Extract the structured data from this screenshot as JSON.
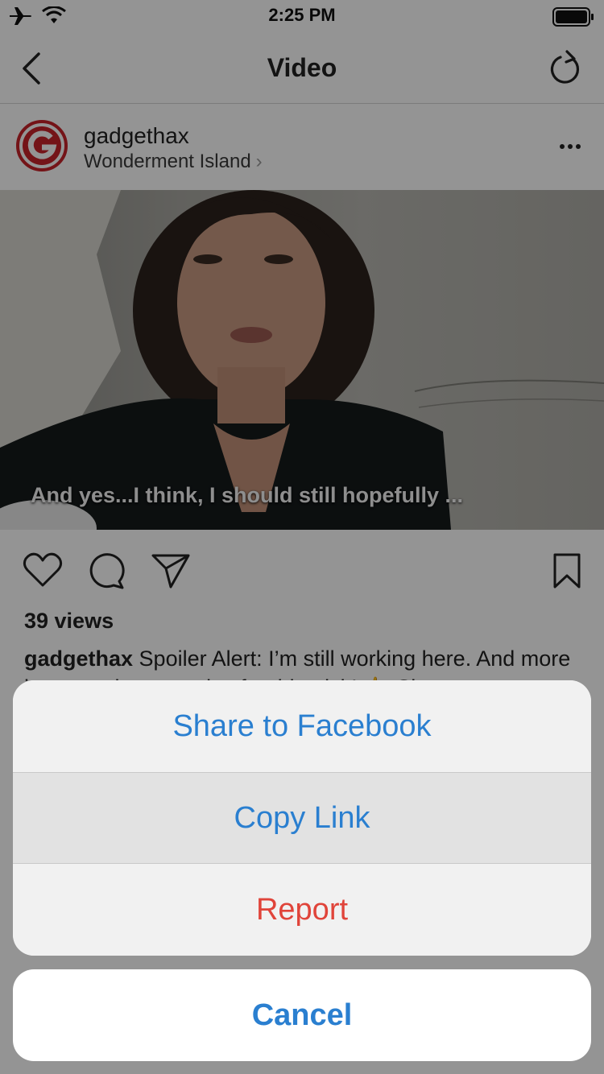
{
  "status_bar": {
    "time": "2:25 PM"
  },
  "nav": {
    "title": "Video"
  },
  "post": {
    "username": "gadgethax",
    "location": "Wonderment Island",
    "video_caption": "And yes...I think, I should still hopefully ...",
    "views": "39 views",
    "caption_user": "gadgethax",
    "caption_text": "Spoiler Alert: I’m still working here. And more importantly, some tips for this trick! 👉 Shorter"
  },
  "action_sheet": {
    "share_facebook": "Share to Facebook",
    "copy_link": "Copy Link",
    "report": "Report",
    "cancel": "Cancel"
  },
  "colors": {
    "ios_blue": "#2a7fd0",
    "destructive_red": "#e0443a",
    "avatar_red": "#c8242a"
  }
}
